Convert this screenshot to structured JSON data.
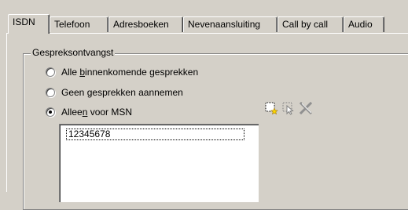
{
  "tabs": [
    {
      "label": "ISDN"
    },
    {
      "label": "Telefoon"
    },
    {
      "label": "Adresboeken"
    },
    {
      "label": "Nevenaansluiting"
    },
    {
      "label": "Call by call"
    },
    {
      "label": "Audio"
    }
  ],
  "group": {
    "title": "Gespreksontvangst",
    "options": [
      {
        "before": "Alle ",
        "accel": "b",
        "after": "innenkomende gesprekken",
        "checked": false
      },
      {
        "before": "Geen ",
        "accel": "g",
        "after": "esprekken aannemen",
        "checked": false
      },
      {
        "before": "Allee",
        "accel": "n",
        "after": " voor MSN",
        "checked": true
      }
    ]
  },
  "msn_list": [
    "12345678"
  ],
  "toolbar": {
    "new_icon": "new-item-icon",
    "edit_icon": "edit-item-icon",
    "delete_icon": "delete-icon"
  }
}
